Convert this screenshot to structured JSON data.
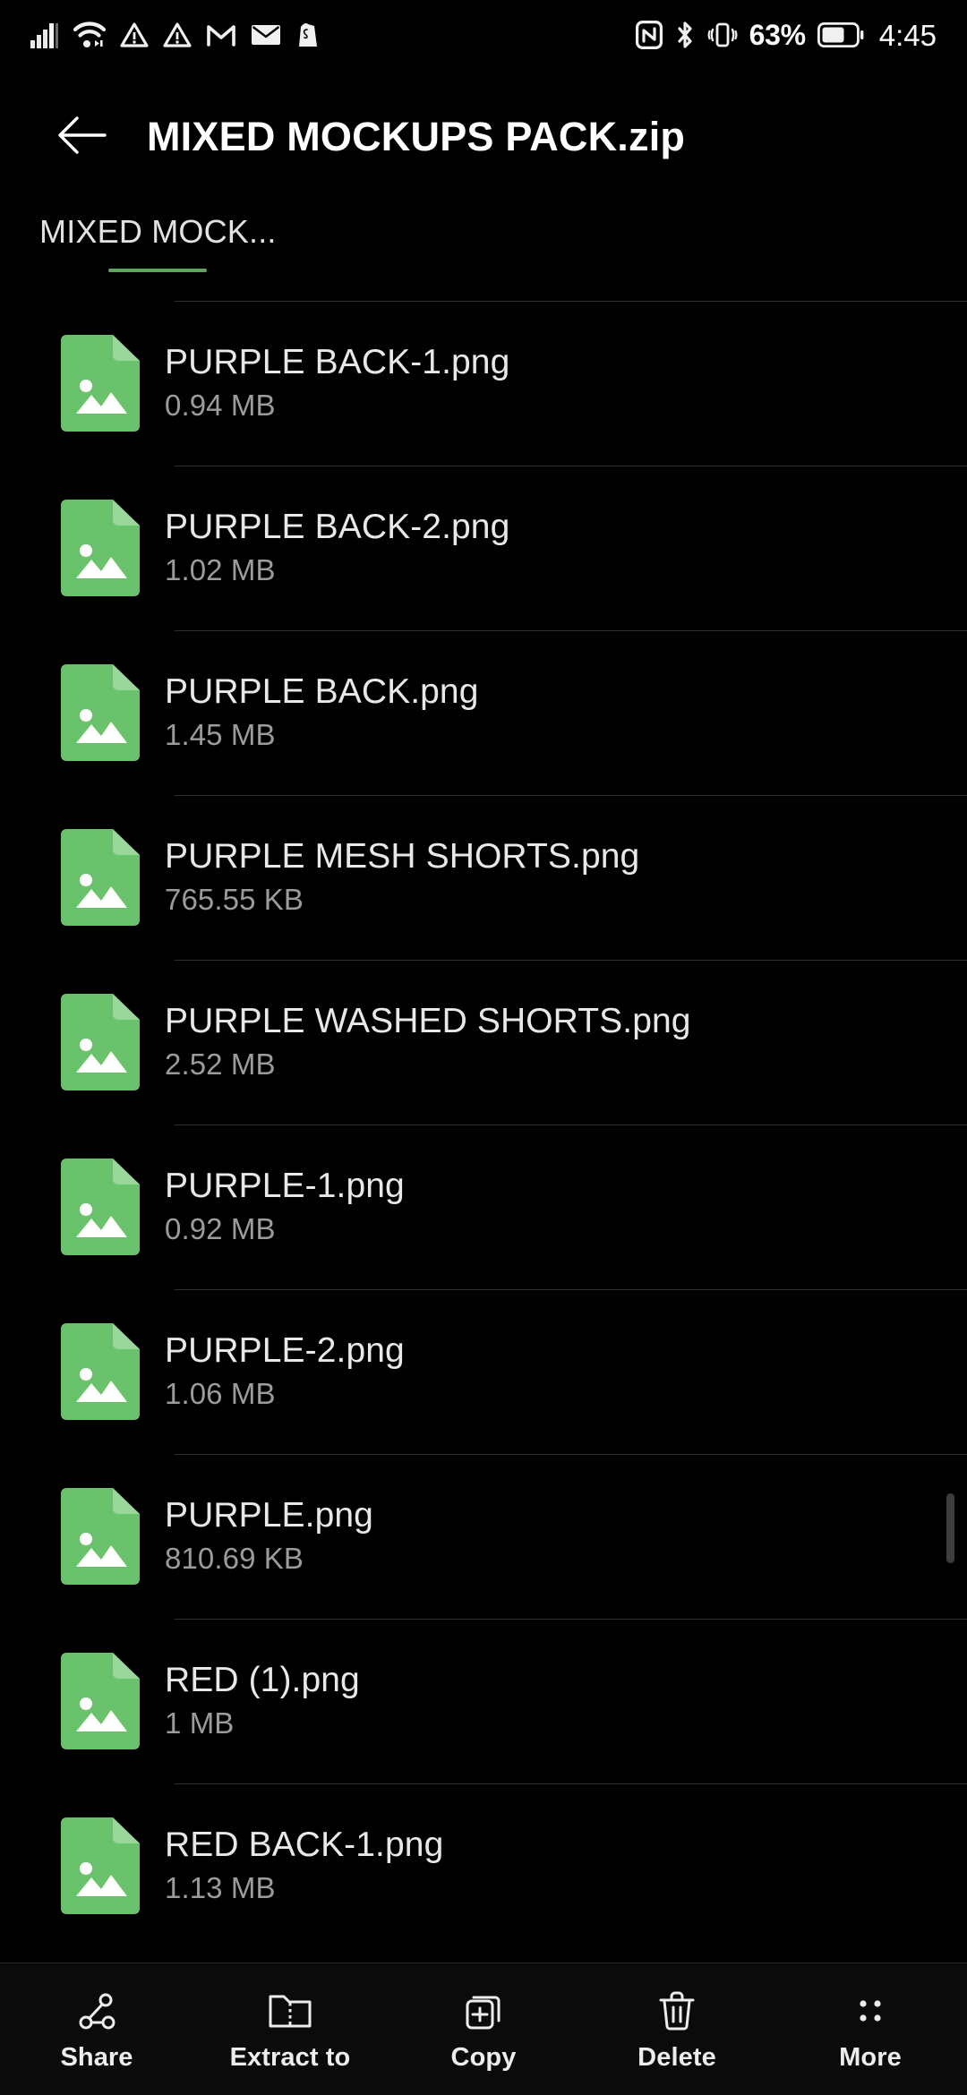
{
  "status_bar": {
    "left_icons": [
      {
        "name": "signal-bars-icon",
        "label": "Cellular signal"
      },
      {
        "name": "wifi-icon",
        "label": "Wi-Fi"
      },
      {
        "name": "warning-triangle-icon",
        "label": "Warning"
      },
      {
        "name": "warning-triangle-2-icon",
        "label": "Warning"
      },
      {
        "name": "gmail-icon",
        "label": "Gmail"
      },
      {
        "name": "email-envelope-icon",
        "label": "Email"
      },
      {
        "name": "shopify-bag-icon",
        "label": "Shopify"
      }
    ],
    "right_icons": [
      {
        "name": "nfc-icon",
        "label": "NFC"
      },
      {
        "name": "bluetooth-icon",
        "label": "Bluetooth"
      },
      {
        "name": "vibrate-icon",
        "label": "Vibrate"
      }
    ],
    "battery_percent": "63%",
    "time": "4:45"
  },
  "header": {
    "title": "MIXED MOCKUPS PACK.zip",
    "back_icon": "arrow-left-icon"
  },
  "breadcrumb": {
    "label": "MIXED MOCK...",
    "accent_color": "#5fa662"
  },
  "file_list": {
    "icon_color": "#6ac26c",
    "items": [
      {
        "name": "PURPLE BACK-1.png",
        "size": "0.94 MB",
        "type": "image"
      },
      {
        "name": "PURPLE BACK-2.png",
        "size": "1.02 MB",
        "type": "image"
      },
      {
        "name": "PURPLE BACK.png",
        "size": "1.45 MB",
        "type": "image"
      },
      {
        "name": "PURPLE MESH SHORTS.png",
        "size": "765.55 KB",
        "type": "image"
      },
      {
        "name": "PURPLE WASHED SHORTS.png",
        "size": "2.52 MB",
        "type": "image"
      },
      {
        "name": "PURPLE-1.png",
        "size": "0.92 MB",
        "type": "image"
      },
      {
        "name": "PURPLE-2.png",
        "size": "1.06 MB",
        "type": "image"
      },
      {
        "name": "PURPLE.png",
        "size": "810.69 KB",
        "type": "image"
      },
      {
        "name": "RED (1).png",
        "size": "1 MB",
        "type": "image"
      },
      {
        "name": "RED BACK-1.png",
        "size": "1.13 MB",
        "type": "image"
      }
    ]
  },
  "bottom_bar": {
    "actions": [
      {
        "label": "Share",
        "icon": "share-nodes-icon"
      },
      {
        "label": "Extract to",
        "icon": "folder-zip-icon"
      },
      {
        "label": "Copy",
        "icon": "copy-plus-icon"
      },
      {
        "label": "Delete",
        "icon": "trash-icon"
      },
      {
        "label": "More",
        "icon": "more-dots-icon"
      }
    ]
  }
}
